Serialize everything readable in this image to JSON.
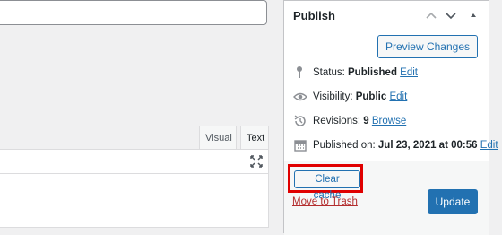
{
  "editor": {
    "tabs": {
      "visual": "Visual",
      "text": "Text"
    }
  },
  "publish": {
    "title": "Publish",
    "preview_label": "Preview Changes",
    "status_label": "Status:",
    "status_value": "Published",
    "visibility_label": "Visibility:",
    "visibility_value": "Public",
    "revisions_label": "Revisions:",
    "revisions_value": "9",
    "published_label": "Published on:",
    "published_value": "Jul 23, 2021 at 00:56",
    "edit_link": "Edit",
    "browse_link": "Browse",
    "clear_cache_label": "Clear cache",
    "trash_label": "Move to Trash",
    "update_label": "Update"
  },
  "colors": {
    "accent": "#2271b1",
    "highlight": "#e00000",
    "trash": "#b32d2e"
  }
}
